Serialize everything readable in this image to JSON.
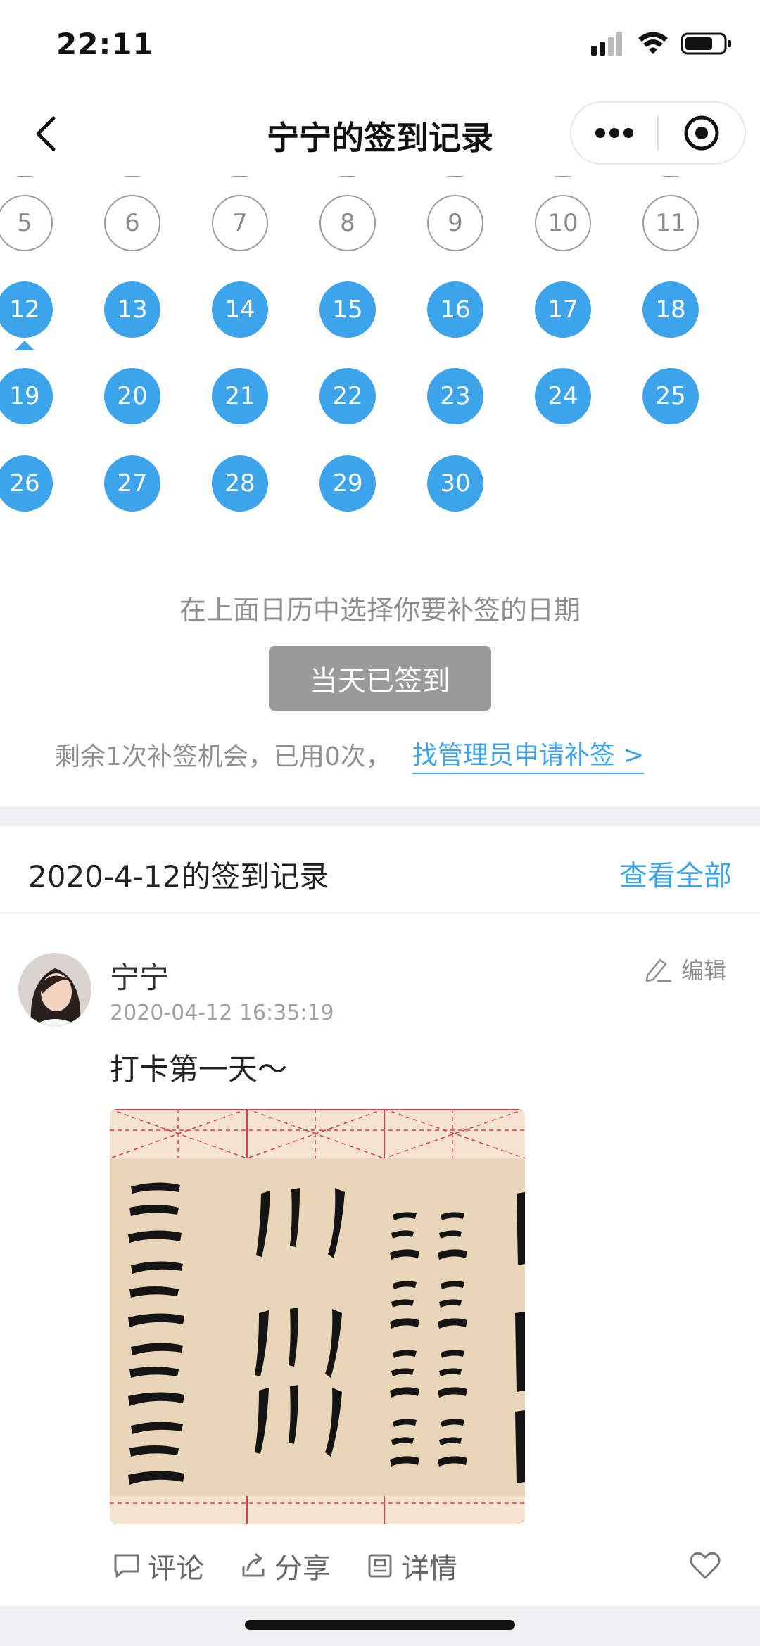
{
  "status_bar": {
    "time": "22:11"
  },
  "nav": {
    "title": "宁宁的签到记录"
  },
  "calendar": {
    "selected_day": "12",
    "partial_row": [
      "",
      "",
      "",
      "",
      "",
      "",
      ""
    ],
    "weeks": [
      {
        "days": [
          {
            "label": "5",
            "signed": false
          },
          {
            "label": "6",
            "signed": false
          },
          {
            "label": "7",
            "signed": false
          },
          {
            "label": "8",
            "signed": false
          },
          {
            "label": "9",
            "signed": false
          },
          {
            "label": "10",
            "signed": false
          },
          {
            "label": "11",
            "signed": false
          }
        ]
      },
      {
        "days": [
          {
            "label": "12",
            "signed": true
          },
          {
            "label": "13",
            "signed": true
          },
          {
            "label": "14",
            "signed": true
          },
          {
            "label": "15",
            "signed": true
          },
          {
            "label": "16",
            "signed": true
          },
          {
            "label": "17",
            "signed": true
          },
          {
            "label": "18",
            "signed": true
          }
        ]
      },
      {
        "days": [
          {
            "label": "19",
            "signed": true
          },
          {
            "label": "20",
            "signed": true
          },
          {
            "label": "21",
            "signed": true
          },
          {
            "label": "22",
            "signed": true
          },
          {
            "label": "23",
            "signed": true
          },
          {
            "label": "24",
            "signed": true
          },
          {
            "label": "25",
            "signed": true
          }
        ]
      },
      {
        "days": [
          {
            "label": "26",
            "signed": true
          },
          {
            "label": "27",
            "signed": true
          },
          {
            "label": "28",
            "signed": true
          },
          {
            "label": "29",
            "signed": true
          },
          {
            "label": "30",
            "signed": true
          }
        ]
      }
    ],
    "signed_color": "#3da3ea"
  },
  "makeup": {
    "hint": "在上面日历中选择你要补签的日期",
    "button_label": "当天已签到",
    "remaining_text": "剩余1次补签机会，已用0次，",
    "apply_link": "找管理员申请补签 >"
  },
  "record": {
    "title": "2020-4-12的签到记录",
    "view_all": "查看全部",
    "post": {
      "author": "宁宁",
      "time": "2020-04-12 16:35:19",
      "edit_label": "编辑",
      "text": "打卡第一天～",
      "actions": {
        "comment": "评论",
        "share": "分享",
        "detail": "详情"
      }
    }
  },
  "colors": {
    "accent": "#3da3ea",
    "muted": "#8e8e8e",
    "button_disabled": "#9a9a9a"
  }
}
